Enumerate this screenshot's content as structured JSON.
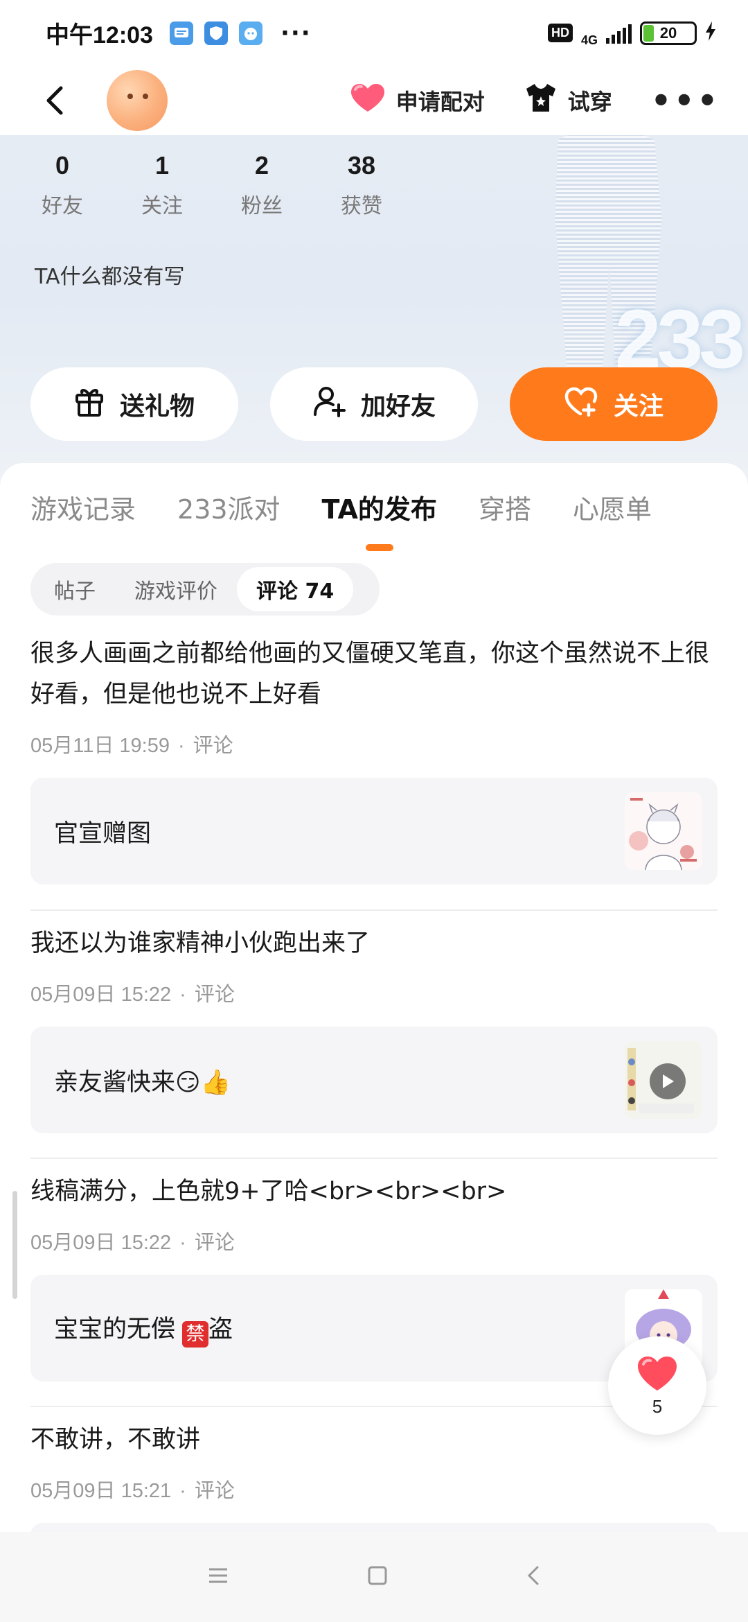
{
  "status_bar": {
    "time": "中午12:03",
    "network": "4G",
    "hd": "HD",
    "battery": "20",
    "more": "···"
  },
  "nav": {
    "pair_label": "申请配对",
    "tryon_label": "试穿"
  },
  "stats": [
    {
      "value": "0",
      "label": "好友"
    },
    {
      "value": "1",
      "label": "关注"
    },
    {
      "value": "2",
      "label": "粉丝"
    },
    {
      "value": "38",
      "label": "获赞"
    }
  ],
  "bio": "TA什么都没有写",
  "decoration_text": "233",
  "actions": {
    "gift": "送礼物",
    "add_friend": "加好友",
    "follow": "关注"
  },
  "tabs": [
    "游戏记录",
    "233派对",
    "TA的发布",
    "穿搭",
    "心愿单"
  ],
  "active_tab": "TA的发布",
  "subtabs": [
    "帖子",
    "游戏评价",
    "评论 74"
  ],
  "active_subtab": "评论 74",
  "comments": [
    {
      "text": "很多人画画之前都给他画的又僵硬又笔直，你这个虽然说不上很好看，但是他也说不上好看",
      "date": "05月11日 19:59",
      "type": "评论",
      "card_title": "官宣赠图"
    },
    {
      "text": "我还以为谁家精神小伙跑出来了",
      "date": "05月09日 15:22",
      "type": "评论",
      "card_title": "亲友酱快来😏👍"
    },
    {
      "text": "线稿满分，上色就9+了哈<br><br><br>",
      "date": "05月09日 15:22",
      "type": "评论",
      "card_title_pre": "宝宝的无偿",
      "card_title_ban": "禁",
      "card_title_post": "盗"
    },
    {
      "text": "不敢讲，不敢讲",
      "date": "05月09日 15:21",
      "type": "评论"
    }
  ],
  "like_count": "5",
  "colors": {
    "accent": "#ff7a1a",
    "like": "#ff4d5e"
  }
}
